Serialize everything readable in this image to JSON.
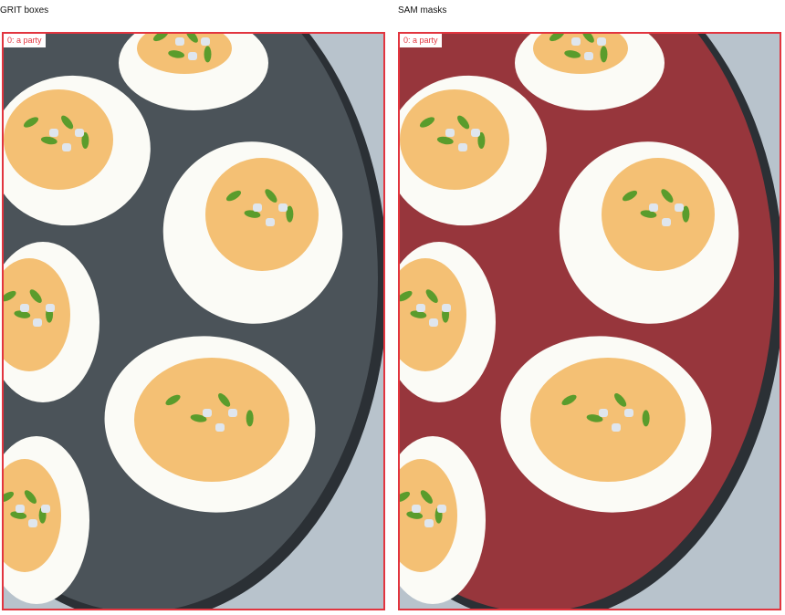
{
  "panels": [
    {
      "title": "GRIT boxes",
      "box_label": "0: a party",
      "plate_color": "#4b5359",
      "box_color": "#e2353f"
    },
    {
      "title": "SAM masks",
      "box_label": "0: a party",
      "plate_color": "#97363c",
      "box_color": "#e2353f"
    }
  ],
  "scene": {
    "background_color": "#b8c3cc",
    "egg_white_color": "#fbfbf6",
    "yolk_color": "#f4c074",
    "herb_color": "#5a9c2c",
    "cheese_color": "#dfe6ee"
  }
}
